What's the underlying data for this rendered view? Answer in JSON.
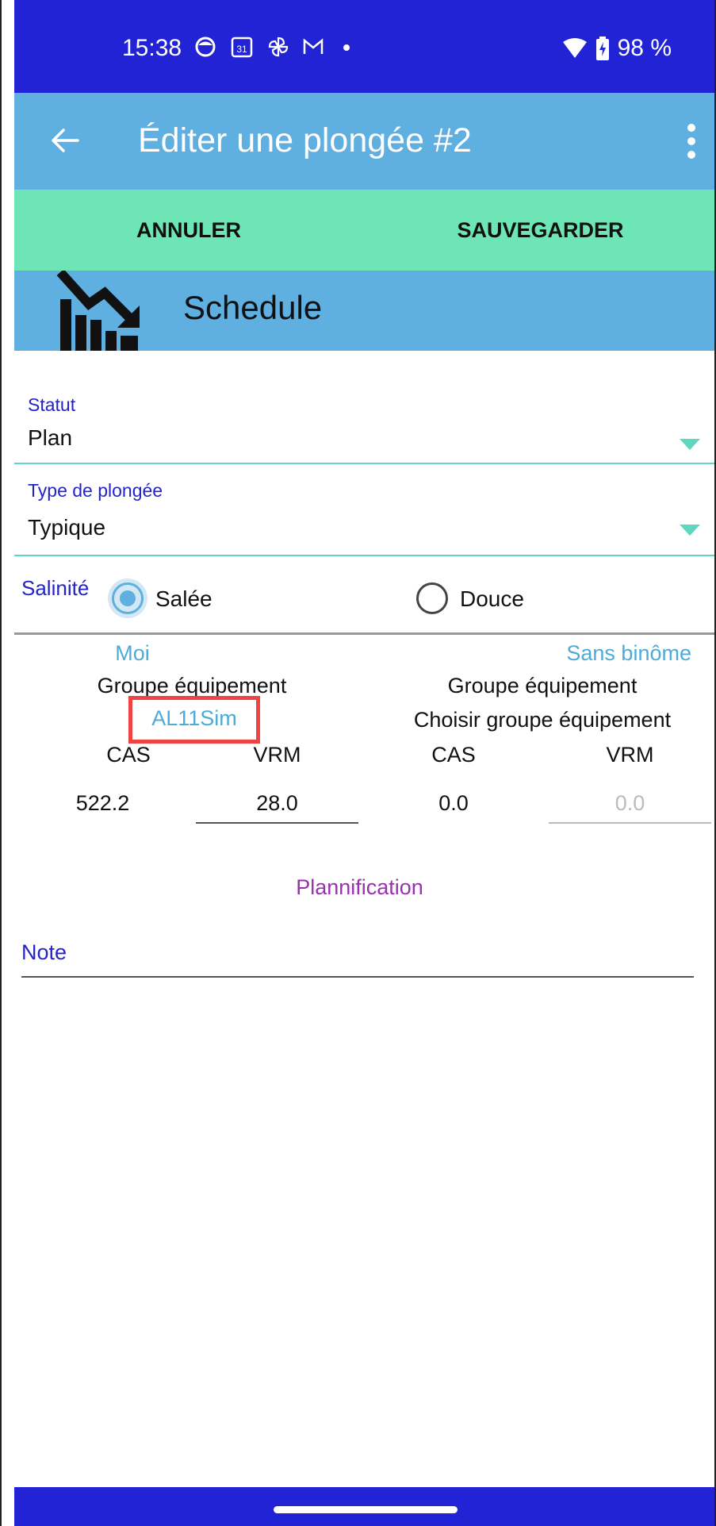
{
  "status_bar": {
    "time": "15:38",
    "battery": "98 %",
    "icons": [
      "face-icon",
      "calendar-icon",
      "pinwheel-icon",
      "gmail-icon",
      "dot-icon",
      "wifi-icon",
      "battery-charging-icon"
    ],
    "calendar_day": "31"
  },
  "app_bar": {
    "title": "Éditer une plongée #2",
    "back_icon": "arrow-left-icon",
    "menu_icon": "more-vert-icon"
  },
  "actions": {
    "cancel_label": "ANNULER",
    "save_label": "SAUVEGARDER"
  },
  "schedule": {
    "title": "Schedule",
    "icon": "trending-down-chart-icon"
  },
  "fields": {
    "status_label": "Statut",
    "status_value": "Plan",
    "dive_type_label": "Type de plongée",
    "dive_type_value": "Typique"
  },
  "salinity": {
    "label": "Salinité",
    "options": [
      {
        "label": "Salée",
        "selected": true
      },
      {
        "label": "Douce",
        "selected": false
      }
    ]
  },
  "gear": {
    "me": {
      "name": "Moi",
      "group_label": "Groupe équipement",
      "group_value": "AL11Sim",
      "cas_label": "CAS",
      "vrm_label": "VRM",
      "cas_value": "522.2",
      "vrm_value": "28.0"
    },
    "buddy": {
      "name": "Sans binôme",
      "group_label": "Groupe équipement",
      "group_value": "Choisir groupe équipement",
      "cas_label": "CAS",
      "vrm_label": "VRM",
      "cas_value": "0.0",
      "vrm_value": "0.0"
    }
  },
  "planning_label": "Plannification",
  "note_label": "Note",
  "colors": {
    "status_bar": "#2323d6",
    "app_bar": "#5fafe0",
    "action_bar": "#6ee5b5",
    "label_blue": "#2323c8",
    "accent_teal": "#5fd6c0",
    "planning_purple": "#9b30b0",
    "highlight": "#ee4444"
  }
}
